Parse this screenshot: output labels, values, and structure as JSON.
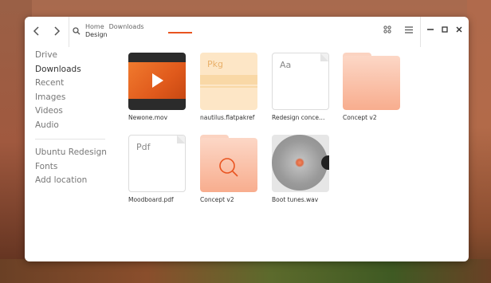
{
  "breadcrumb": {
    "items": [
      "Home",
      "Downloads"
    ],
    "current": "Design"
  },
  "sidebar": {
    "places": [
      {
        "label": "Drive",
        "active": false
      },
      {
        "label": "Downloads",
        "active": true
      },
      {
        "label": "Recent",
        "active": false
      },
      {
        "label": "Images",
        "active": false
      },
      {
        "label": "Videos",
        "active": false
      },
      {
        "label": "Audio",
        "active": false
      }
    ],
    "other": [
      {
        "label": "Ubuntu Redesign"
      },
      {
        "label": "Fonts"
      },
      {
        "label": "Add location"
      }
    ]
  },
  "files": [
    {
      "name": "Newone.mov",
      "kind": "video"
    },
    {
      "name": "nautilus.flatpakref",
      "kind": "package",
      "badge": "Pkg"
    },
    {
      "name": "Redesign conce…",
      "kind": "font",
      "badge": "Aa"
    },
    {
      "name": "Concept v2",
      "kind": "folder"
    },
    {
      "name": "Moodboard.pdf",
      "kind": "pdf",
      "badge": "Pdf"
    },
    {
      "name": "Concept v2",
      "kind": "folder-search"
    },
    {
      "name": "Boot tunes.wav",
      "kind": "audio"
    }
  ],
  "colors": {
    "accent": "#e95420",
    "folder_top": "#fbd0bd",
    "folder_bottom": "#f6a98a"
  }
}
